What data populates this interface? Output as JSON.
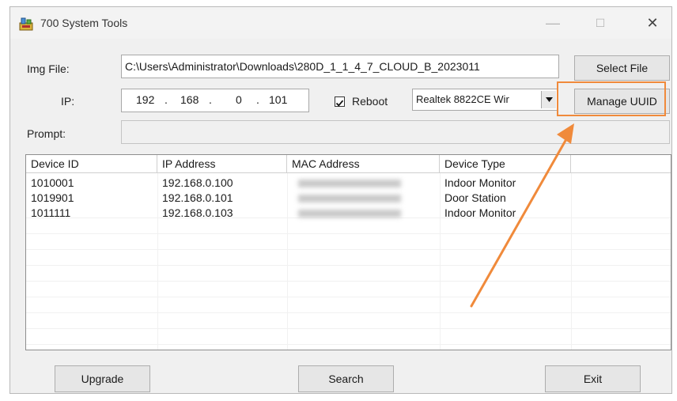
{
  "window": {
    "title": "700 System Tools",
    "controls": {
      "minimize": "—",
      "maximize": "☐",
      "close": "✕"
    }
  },
  "form": {
    "img_file_label": "Img File:",
    "img_file_value": "C:\\Users\\Administrator\\Downloads\\280D_1_1_4_7_CLOUD_B_2023011",
    "ip_label": "IP:",
    "ip_octets": [
      "192",
      "168",
      "0",
      "101"
    ],
    "reboot_label": "Reboot",
    "reboot_checked": true,
    "network_adapter": "Realtek 8822CE Wir",
    "prompt_label": "Prompt:",
    "prompt_value": "",
    "select_file_button": "Select File",
    "manage_uuid_button": "Manage UUID"
  },
  "table": {
    "columns": [
      "Device ID",
      "IP Address",
      "MAC Address",
      "Device Type"
    ],
    "rows": [
      {
        "device_id": "1010001",
        "ip": "192.168.0.100",
        "mac": "",
        "type": "Indoor Monitor"
      },
      {
        "device_id": "1019901",
        "ip": "192.168.0.101",
        "mac": "",
        "type": "Door Station"
      },
      {
        "device_id": "1011111",
        "ip": "192.168.0.103",
        "mac": "",
        "type": "Indoor Monitor"
      }
    ]
  },
  "buttons": {
    "upgrade": "Upgrade",
    "search": "Search",
    "exit": "Exit"
  },
  "annotation": {
    "highlight_color": "#f08a3b"
  }
}
